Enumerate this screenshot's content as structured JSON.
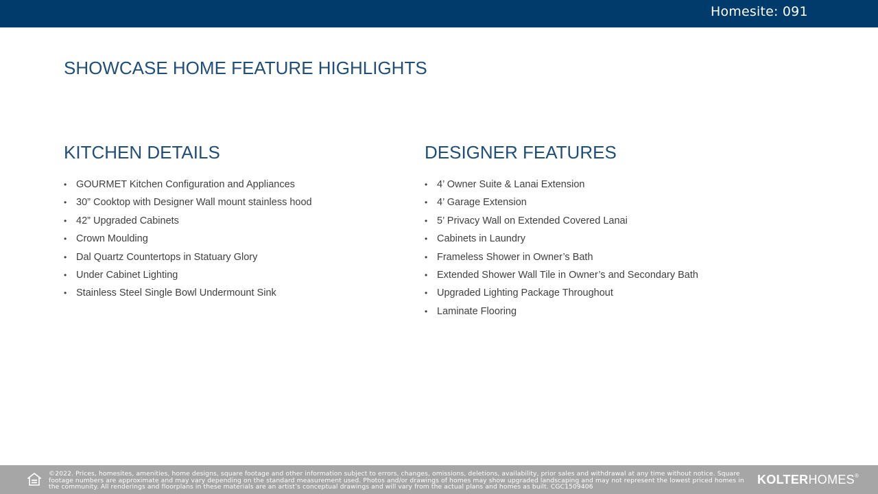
{
  "header": {
    "homesite_label": "Homesite: 091"
  },
  "page": {
    "title": "SHOWCASE HOME FEATURE HIGHLIGHTS"
  },
  "kitchen": {
    "heading": "KITCHEN DETAILS",
    "items": [
      "GOURMET Kitchen Configuration and Appliances",
      "30” Cooktop with Designer Wall mount stainless hood",
      "42” Upgraded Cabinets",
      "Crown Moulding",
      "Dal Quartz Countertops in Statuary Glory",
      "Under Cabinet Lighting",
      "Stainless Steel Single Bowl Undermount Sink"
    ]
  },
  "designer": {
    "heading": "DESIGNER FEATURES",
    "items": [
      "4’ Owner Suite & Lanai Extension",
      "4’ Garage Extension",
      "5’ Privacy Wall on Extended Covered Lanai",
      "Cabinets in Laundry",
      "Frameless Shower in Owner’s Bath",
      "Extended Shower Wall Tile in Owner’s and Secondary Bath",
      "Upgraded Lighting Package Throughout",
      "Laminate Flooring"
    ]
  },
  "footer": {
    "disclaimer": "©2022. Prices, homesites, amenities, home designs, square footage and other information subject to errors, changes, omissions, deletions, availability, prior sales and withdrawal at any time without notice. Square footage numbers are approximate and may vary depending on the standard measurement used. Photos and/or drawings of homes may show upgraded landscaping and may not represent the lowest priced homes in the community. All renderings and floorplans in these materials are an artist’s conceptual drawings and will vary from the actual plans and homes as built. CGC1509406",
    "brand_bold": "KOLTER",
    "brand_light": "HOMES",
    "brand_mark": "®"
  },
  "colors": {
    "header_bar": "#003b6b",
    "heading_text": "#1f4e79",
    "body_text": "#404040",
    "footer_bar": "#a6a6a6"
  },
  "icons": {
    "footer_logo": "equal-housing-opportunity-icon"
  }
}
